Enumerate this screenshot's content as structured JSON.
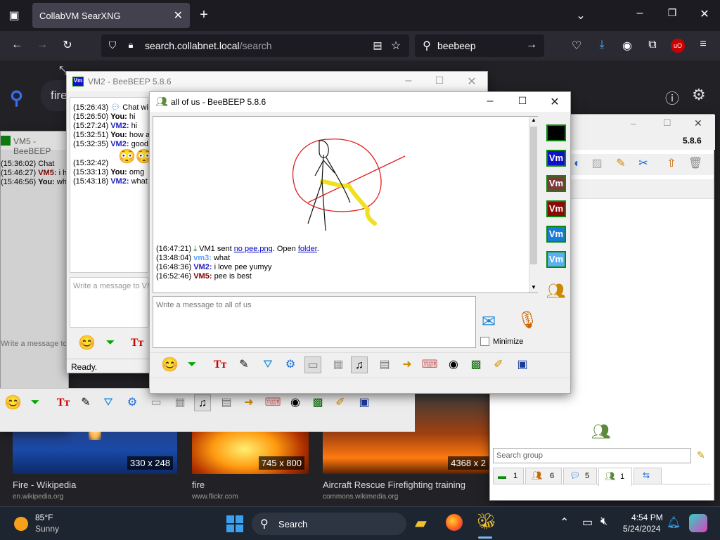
{
  "browser": {
    "tab_title": "CollabVM SearXNG",
    "url_host": "search.collabnet.local",
    "url_path": "/search",
    "search_query": "beebeep"
  },
  "page": {
    "query_partial": "fire",
    "results": [
      {
        "dims": "330 x 248",
        "title": "Fire - Wikipedia",
        "url": "en.wikipedia.org"
      },
      {
        "dims": "745 x 800",
        "title": "fire",
        "url": "www.flickr.com"
      },
      {
        "dims": "4368 x 2",
        "title": "Aircraft Rescue Firefighting training",
        "url": "commons.wikimedia.org"
      }
    ]
  },
  "vm2_window": {
    "title": "VM2 - BeeBEEP 5.8.6",
    "messages": [
      {
        "time": "(15:26:43)",
        "nick": "",
        "text": "Chat wi"
      },
      {
        "time": "(15:26:50)",
        "nick": "You:",
        "text": "hi"
      },
      {
        "time": "(15:27:24)",
        "nick": "VM2:",
        "text": "hi"
      },
      {
        "time": "(15:32:51)",
        "nick": "You:",
        "text": "how a"
      },
      {
        "time": "(15:32:35)",
        "nick": "VM2:",
        "text": "good"
      },
      {
        "time": "(15:32:42)",
        "nick": "",
        "text": ""
      },
      {
        "time": "(15:33:13)",
        "nick": "You:",
        "text": "omg"
      },
      {
        "time": "(15:43:18)",
        "nick": "VM2:",
        "text": "what"
      }
    ],
    "input_placeholder": "Write a message to VM",
    "status": "Ready."
  },
  "vm5_window": {
    "title": "VM5 - BeeBEEP",
    "messages": [
      {
        "time": "(15:36:02)",
        "nick": "",
        "text": "Chat"
      },
      {
        "time": "(15:46:27)",
        "nick": "VM5:",
        "text": "i h"
      },
      {
        "time": "(15:46:56)",
        "nick": "You:",
        "text": "wh"
      }
    ],
    "input_placeholder": "Write a message to"
  },
  "group_window": {
    "title": "all of us - BeeBEEP 5.8.6",
    "messages": [
      {
        "time": "(16:47:21)",
        "pre": "VM1 sent",
        "link1": "no pee.png",
        "mid": ". Open",
        "link2": "folder",
        "post": "."
      },
      {
        "time": "(13:48:04)",
        "nick": "vm3:",
        "text": "what"
      },
      {
        "time": "(16:48:36)",
        "nick": "VM2:",
        "text": "i love pee yumyy"
      },
      {
        "time": "(16:52:46)",
        "nick": "VM5:",
        "text": "pee is best"
      }
    ],
    "input_placeholder": "Write a message to all of us",
    "minimize_label": "Minimize",
    "member_badges": [
      {
        "label": "",
        "bg": "#000000",
        "border": "#0a8a0a"
      },
      {
        "label": "Vm",
        "bg": "#1010c8",
        "border": "#0a8a0a"
      },
      {
        "label": "Vm",
        "bg": "#7a3a3a",
        "border": "#0a8a0a"
      },
      {
        "label": "Vm",
        "bg": "#8a0a0a",
        "border": "#0a8a0a"
      },
      {
        "label": "Vm",
        "bg": "#1a7ad8",
        "border": "#0a8a0a"
      },
      {
        "label": "Vm",
        "bg": "#5ab0f0",
        "border": "#0a8a0a"
      }
    ]
  },
  "main_window": {
    "version": "5.8.6",
    "search_placeholder": "Search group",
    "tabs": [
      {
        "count": "1"
      },
      {
        "count": "6"
      },
      {
        "count": "5"
      },
      {
        "count": "1"
      },
      {
        "count": ""
      }
    ]
  },
  "taskbar": {
    "weather_temp": "85°F",
    "weather_desc": "Sunny",
    "search_label": "Search",
    "time": "4:54 PM",
    "date": "5/24/2024"
  },
  "colors": {
    "accent_blue": "#0b5fff",
    "sketch_red": "#e02020",
    "sketch_yellow": "#f0e020"
  }
}
